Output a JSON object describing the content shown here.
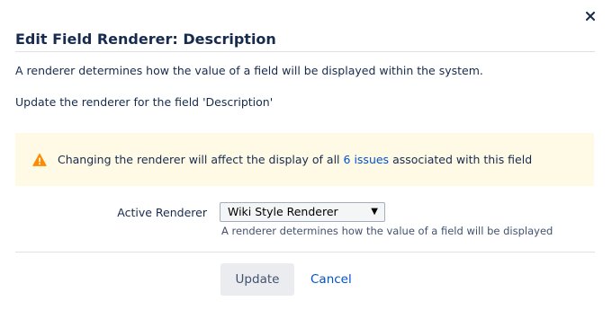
{
  "dialog": {
    "title": "Edit Field Renderer: Description",
    "close_icon": "close-icon",
    "intro": "A renderer determines how the value of a field will be displayed within the system.",
    "update_text": "Update the renderer for the field 'Description'"
  },
  "warning": {
    "icon": "warning-icon",
    "color": "#ff8b00",
    "background": "#fffae6",
    "text_before": "Changing the renderer will affect the display of all",
    "link_text": "6 issues",
    "text_after": "associated with this field"
  },
  "form": {
    "label": "Active Renderer",
    "selected": "Wiki Style Renderer",
    "description": "A renderer determines how the value of a field will be displayed"
  },
  "footer": {
    "update_label": "Update",
    "cancel_label": "Cancel"
  }
}
